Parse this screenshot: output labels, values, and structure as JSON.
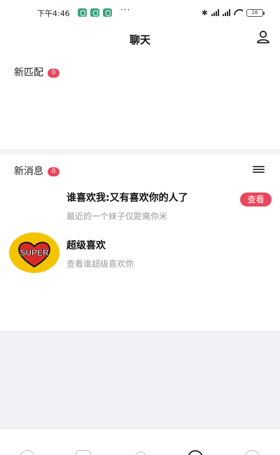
{
  "status_bar": {
    "time": "下午4:46",
    "dots": "···",
    "bluetooth": "✱",
    "battery": "26"
  },
  "header": {
    "title": "聊天",
    "profile_icon": "person-icon"
  },
  "new_matches": {
    "label": "新匹配",
    "count": "0"
  },
  "new_messages": {
    "label": "新消息",
    "count": "0",
    "menu_icon": "menu-icon",
    "items": [
      {
        "title": "谁喜欢我:又有喜欢你的人了",
        "subtitle": "最近的一个妹子仅距离你米",
        "action": "查看"
      },
      {
        "title": "超级喜欢",
        "subtitle": "查看谁超级喜欢你",
        "avatar_text": "SUPER"
      }
    ]
  },
  "colors": {
    "accent": "#e8485f",
    "super_yellow": "#f5c400",
    "super_red": "#d62b2b",
    "divider": "#f3f3f5"
  },
  "tab_bar": {
    "icons": [
      "home-icon",
      "chat-icon",
      "heart-icon",
      "message-icon",
      "profile-icon"
    ],
    "active": "message-icon"
  }
}
